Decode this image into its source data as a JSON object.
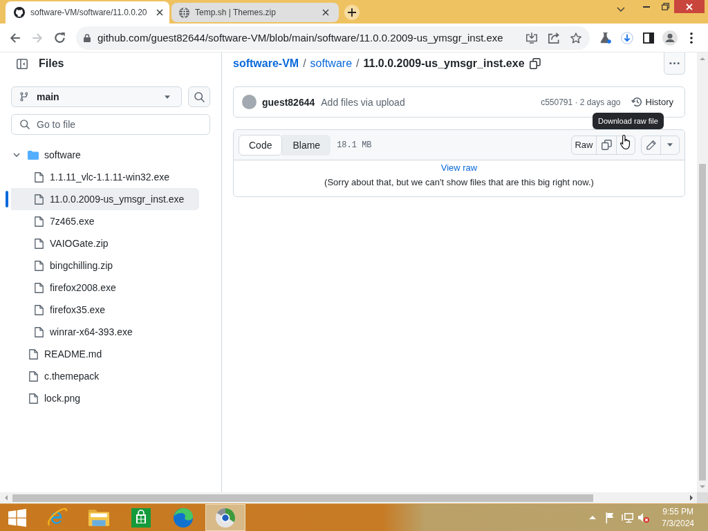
{
  "browser": {
    "tabs": [
      {
        "kind": "logo",
        "title": "software-VM/software/11.0.0.20",
        "selected": true
      },
      {
        "kind": "globe",
        "title": "Temp.sh | Themes.zip",
        "selected": false
      }
    ],
    "forward": {
      "disabled": true
    },
    "url": "github.com/guest82644/software-VM/blob/main/software/11.0.0.2009-us_ymsgr_inst.exe"
  },
  "sidebar": {
    "title": "Files",
    "branch": "main",
    "search": {
      "placeholder": "Go to file"
    },
    "tree": [
      {
        "kind": "folder",
        "name": "software",
        "expanded": true,
        "selected": false,
        "children": [
          {
            "kind": "file",
            "name": "1.1.11_vlc-1.1.11-win32.exe",
            "selected": false
          },
          {
            "kind": "file",
            "name": "11.0.0.2009-us_ymsgr_inst.exe",
            "selected": true
          },
          {
            "kind": "file",
            "name": "7z465.exe",
            "selected": false
          },
          {
            "kind": "file",
            "name": "VAIOGate.zip",
            "selected": false
          },
          {
            "kind": "file",
            "name": "bingchilling.zip",
            "selected": false
          },
          {
            "kind": "file",
            "name": "firefox2008.exe",
            "selected": false
          },
          {
            "kind": "file",
            "name": "firefox35.exe",
            "selected": false
          },
          {
            "kind": "file",
            "name": "winrar-x64-393.exe",
            "selected": false
          }
        ]
      },
      {
        "kind": "file",
        "name": "README.md",
        "selected": false
      },
      {
        "kind": "file",
        "name": "c.themepack",
        "selected": false
      },
      {
        "kind": "file",
        "name": "lock.png",
        "selected": false
      }
    ]
  },
  "breadcrumb": [
    {
      "kind": "repo",
      "text": "software-VM"
    },
    {
      "kind": "separator",
      "text": "/"
    },
    {
      "kind": "link",
      "text": "software"
    },
    {
      "kind": "separator",
      "text": "/"
    },
    {
      "kind": "current",
      "text": "11.0.0.2009-us_ymsgr_inst.exe"
    }
  ],
  "commit": {
    "author": "guest82644",
    "message": "Add files via upload",
    "info": "c550791 · 2 days ago",
    "history": "History"
  },
  "file_view": {
    "tabs": [
      {
        "label": "Code",
        "selected": true
      },
      {
        "label": "Blame",
        "selected": false
      }
    ],
    "size": "18.1 MB",
    "raw": "Raw",
    "tooltip": "Download raw file",
    "view_raw": "View raw",
    "notice": "(Sorry about that, but we can't show files that are this big right now.)"
  },
  "taskbar": {
    "apps": [
      {
        "kind": "ie",
        "active": false
      },
      {
        "kind": "explorer",
        "active": false
      },
      {
        "kind": "store",
        "active": false
      },
      {
        "kind": "edge",
        "active": false
      },
      {
        "kind": "orb",
        "active": true
      }
    ],
    "clock": {
      "time": "9:55 PM",
      "date": "7/3/2024"
    }
  }
}
